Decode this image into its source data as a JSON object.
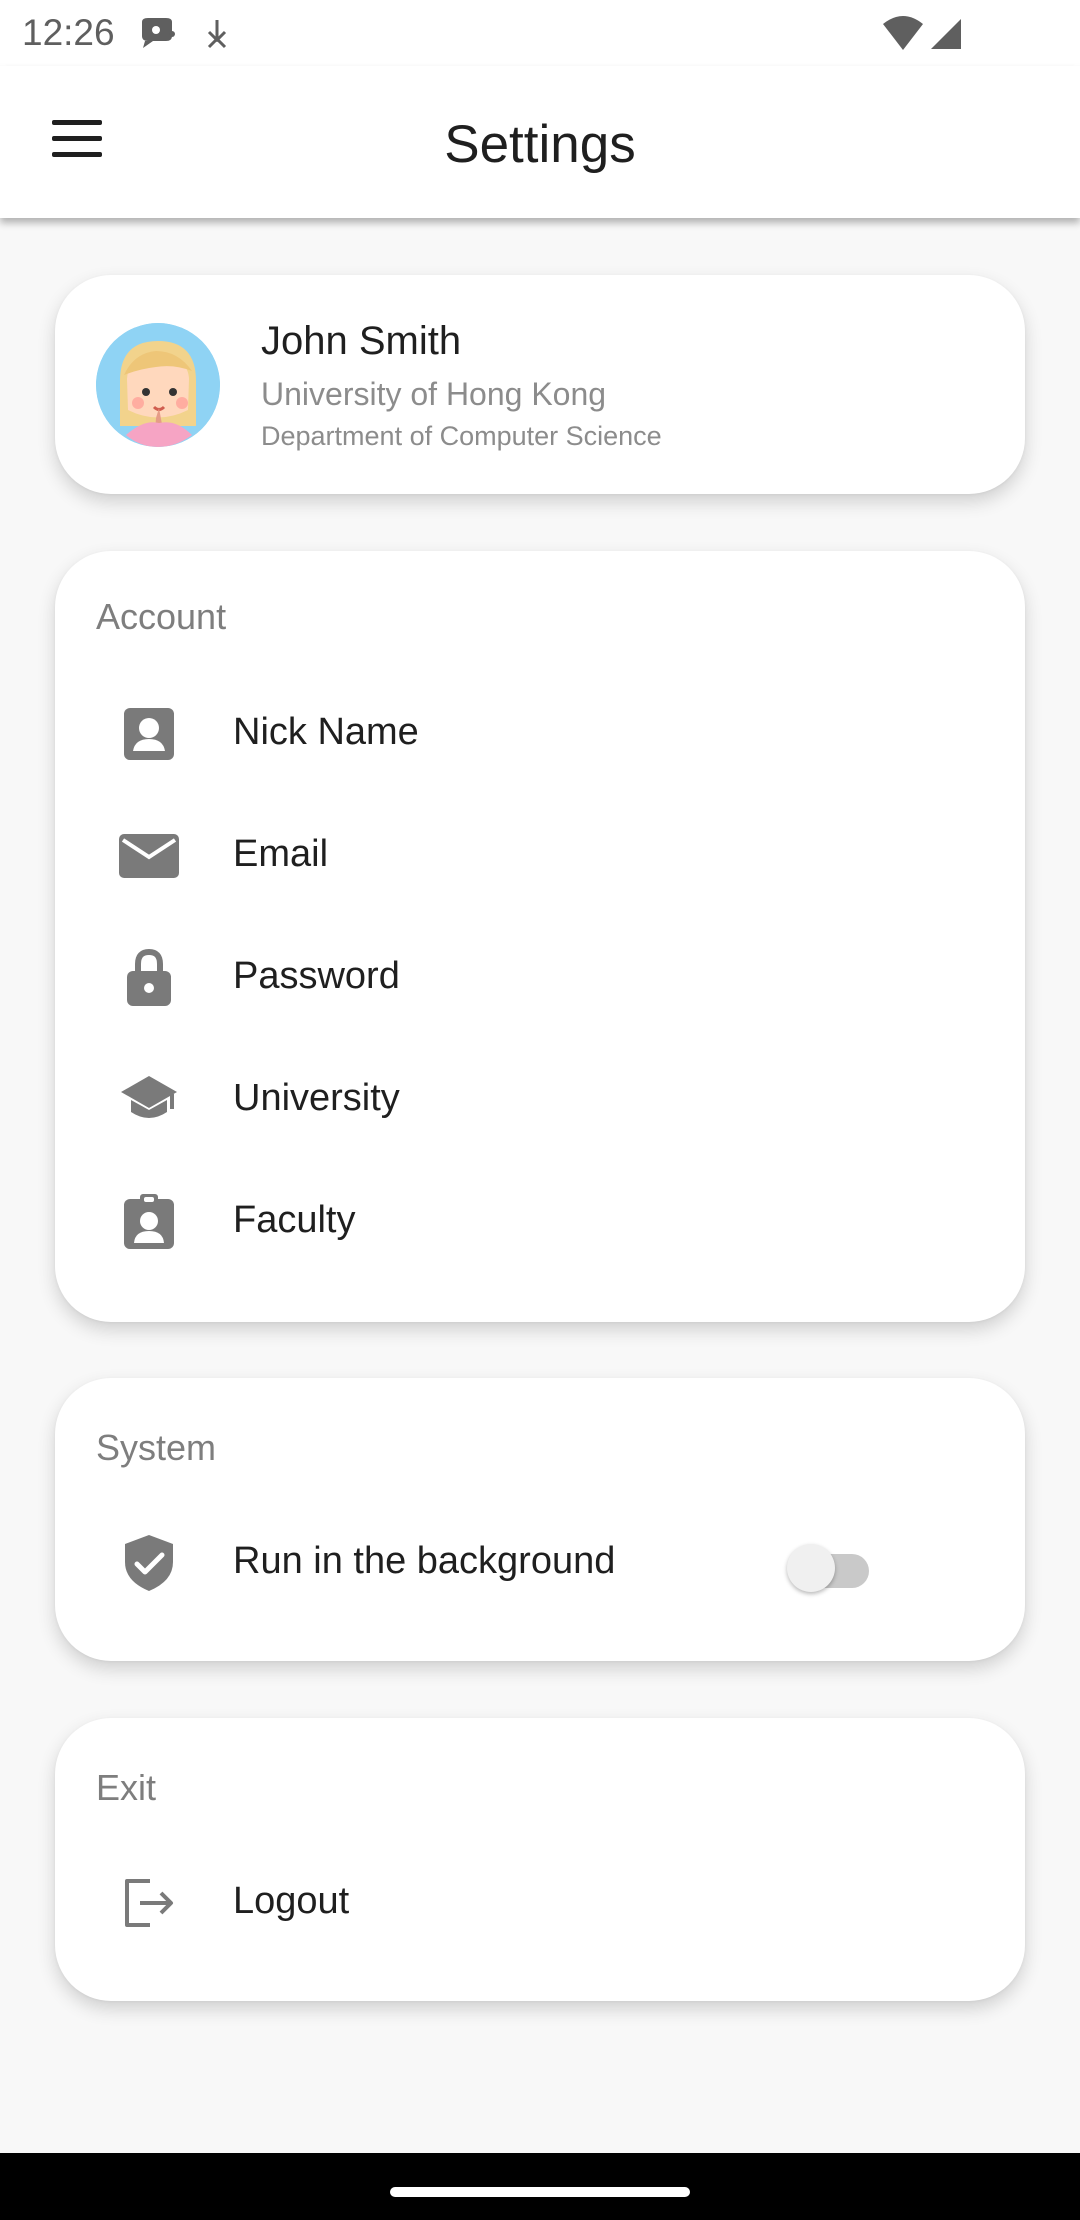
{
  "status_bar": {
    "time": "12:26",
    "icons": [
      "chat-bubble-icon",
      "download-icon",
      "wifi-icon",
      "signal-icon"
    ]
  },
  "app_bar": {
    "title": "Settings",
    "menu_icon": "hamburger-menu-icon"
  },
  "profile": {
    "name": "John Smith",
    "university": "University of Hong Kong",
    "department": "Department of Computer Science",
    "avatar": "avatar-icon"
  },
  "sections": {
    "account": {
      "title": "Account",
      "items": [
        {
          "label": "Nick Name",
          "icon": "person-icon"
        },
        {
          "label": "Email",
          "icon": "mail-icon"
        },
        {
          "label": "Password",
          "icon": "lock-icon"
        },
        {
          "label": "University",
          "icon": "school-icon"
        },
        {
          "label": "Faculty",
          "icon": "badge-icon"
        }
      ]
    },
    "system": {
      "title": "System",
      "items": [
        {
          "label": "Run in the background",
          "icon": "shield-check-icon",
          "enabled": false
        }
      ]
    },
    "exit": {
      "title": "Exit",
      "items": [
        {
          "label": "Logout",
          "icon": "logout-icon"
        }
      ]
    }
  },
  "colors": {
    "background": "#f8f8f8",
    "card": "#ffffff",
    "primary_text": "#1f1f1f",
    "secondary_text": "#8c8c8c",
    "icon": "#7a7a7a",
    "toggle_off_track": "#c9c9c9",
    "toggle_off_thumb": "#f0f0f0"
  }
}
